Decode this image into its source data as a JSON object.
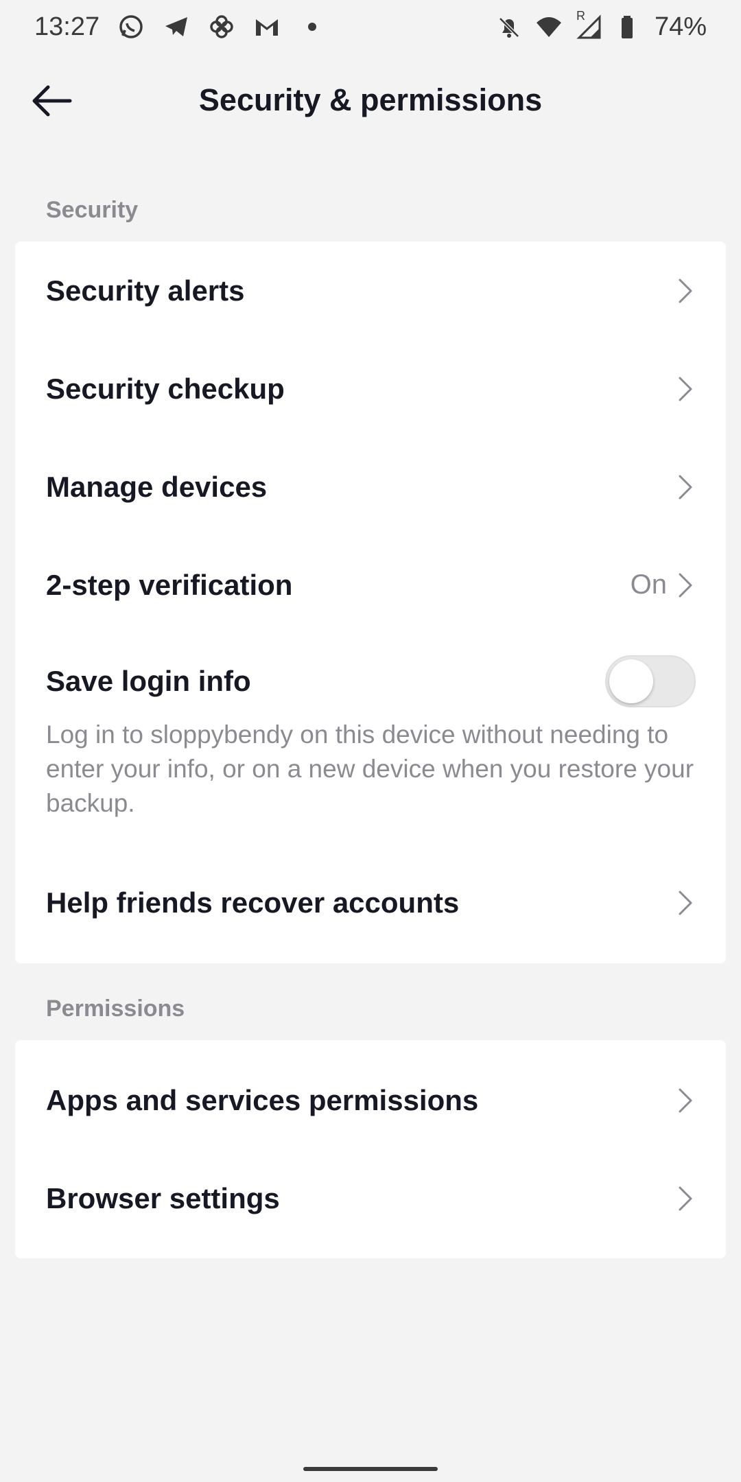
{
  "status_bar": {
    "time": "13:27",
    "left_icons": [
      "whatsapp-icon",
      "telegram-icon",
      "pinwheel-icon",
      "gmail-icon",
      "dot-icon"
    ],
    "right_icons": [
      "bell-off-icon",
      "wifi-icon",
      "signal-icon",
      "battery-icon"
    ],
    "roaming_marker": "R",
    "battery": "74%"
  },
  "header": {
    "title": "Security & permissions",
    "back_icon": "arrow-left-icon"
  },
  "sections": {
    "security": {
      "label": "Security",
      "items": [
        {
          "label": "Security alerts"
        },
        {
          "label": "Security checkup"
        },
        {
          "label": "Manage devices"
        },
        {
          "label": "2-step verification",
          "value": "On"
        }
      ],
      "save_login": {
        "label": "Save login info",
        "enabled": false,
        "description": "Log in to sloppybendy on this device without needing to enter your info, or on a new device when you restore your backup."
      },
      "help_friends": {
        "label": "Help friends recover accounts"
      }
    },
    "permissions": {
      "label": "Permissions",
      "items": [
        {
          "label": "Apps and services permissions"
        },
        {
          "label": "Browser settings"
        }
      ]
    }
  },
  "colors": {
    "background": "#f3f3f3",
    "card": "#ffffff",
    "text_primary": "#161823",
    "text_secondary": "#8a8b91",
    "toggle_off": "#e8e8e8"
  }
}
